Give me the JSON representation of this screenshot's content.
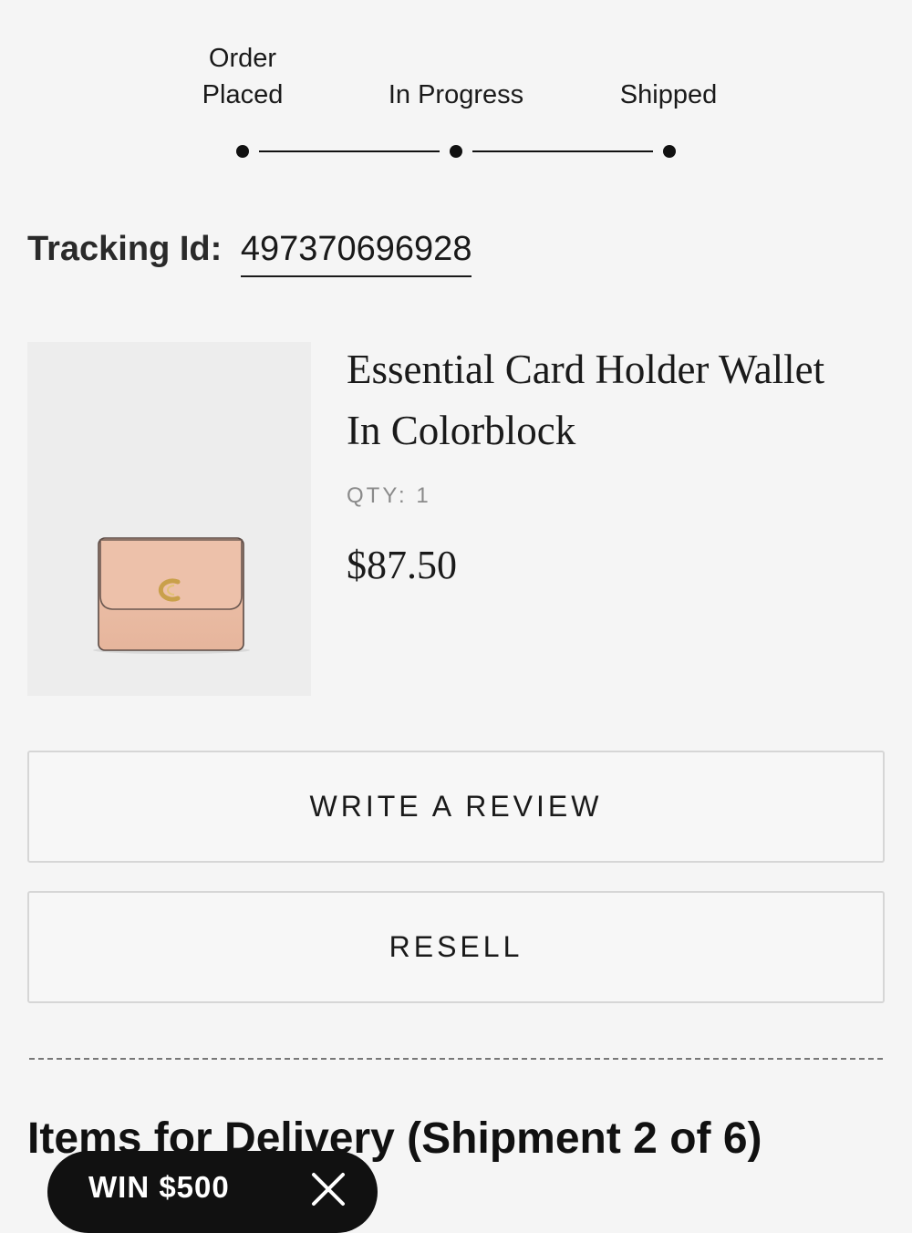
{
  "tracker": {
    "steps": [
      {
        "label": "Order\nPlaced"
      },
      {
        "label": "In Progress"
      },
      {
        "label": "Shipped"
      }
    ]
  },
  "tracking": {
    "label": "Tracking Id:",
    "id": "497370696928"
  },
  "product": {
    "name": "Essential Card Holder Wallet In Colorblock",
    "qty": "QTY: 1",
    "price": "$87.50",
    "image_icon": "wallet-product-image",
    "wallet_color": "#ecbea6",
    "logo_color": "#c9a04a"
  },
  "actions": {
    "review_label": "WRITE A REVIEW",
    "resell_label": "RESELL"
  },
  "section": {
    "title": "Items for Delivery (Shipment 2 of 6)"
  },
  "promo": {
    "label": "WIN $500",
    "close_icon": "close-icon"
  }
}
